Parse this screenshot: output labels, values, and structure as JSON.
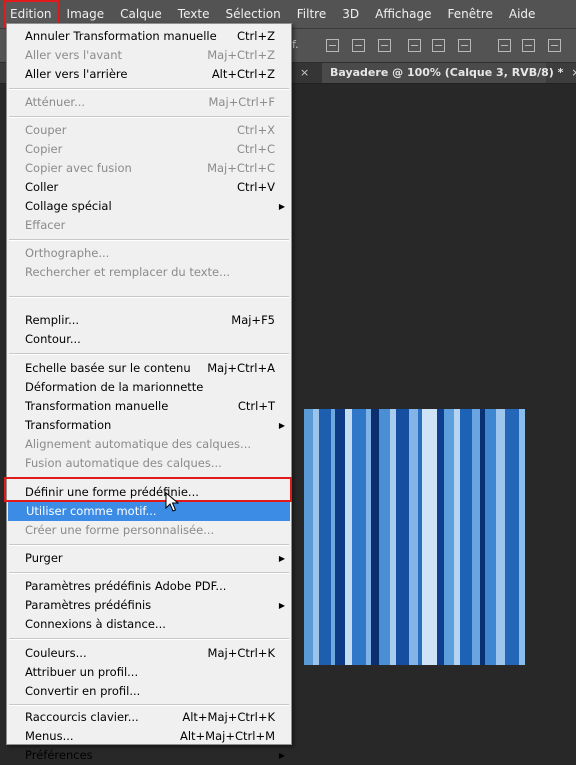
{
  "menubar": {
    "items": [
      "Edition",
      "Image",
      "Calque",
      "Texte",
      "Sélection",
      "Filtre",
      "3D",
      "Affichage",
      "Fenêtre",
      "Aide"
    ]
  },
  "options": {
    "label_fragment": "f."
  },
  "tabs": {
    "active": "Bayadere @ 100% (Calque 3, RVB/8) *",
    "close_glyph": "×"
  },
  "menu": {
    "g1": [
      {
        "label": "Annuler Transformation manuelle",
        "shortcut": "Ctrl+Z",
        "disabled": false
      },
      {
        "label": "Aller vers l'avant",
        "shortcut": "Maj+Ctrl+Z",
        "disabled": true
      },
      {
        "label": "Aller vers l'arrière",
        "shortcut": "Alt+Ctrl+Z",
        "disabled": false
      }
    ],
    "g2": [
      {
        "label": "Atténuer...",
        "shortcut": "Maj+Ctrl+F",
        "disabled": true
      }
    ],
    "g3": [
      {
        "label": "Couper",
        "shortcut": "Ctrl+X",
        "disabled": true
      },
      {
        "label": "Copier",
        "shortcut": "Ctrl+C",
        "disabled": true
      },
      {
        "label": "Copier avec fusion",
        "shortcut": "Maj+Ctrl+C",
        "disabled": true
      },
      {
        "label": "Coller",
        "shortcut": "Ctrl+V",
        "disabled": false
      },
      {
        "label": "Collage spécial",
        "shortcut": "",
        "disabled": false,
        "submenu": true
      },
      {
        "label": "Effacer",
        "shortcut": "",
        "disabled": true
      }
    ],
    "g4": [
      {
        "label": "Orthographe...",
        "shortcut": "",
        "disabled": true
      },
      {
        "label": "Rechercher et remplacer du texte...",
        "shortcut": "",
        "disabled": true
      }
    ],
    "g5": [
      {
        "label": "Remplir...",
        "shortcut": "Maj+F5",
        "disabled": false
      },
      {
        "label": "Contour...",
        "shortcut": "",
        "disabled": false
      }
    ],
    "g6": [
      {
        "label": "Echelle basée sur le contenu",
        "shortcut": "Maj+Ctrl+A",
        "disabled": false
      },
      {
        "label": "Déformation de la marionnette",
        "shortcut": "",
        "disabled": false
      },
      {
        "label": "Transformation manuelle",
        "shortcut": "Ctrl+T",
        "disabled": false
      },
      {
        "label": "Transformation",
        "shortcut": "",
        "disabled": false,
        "submenu": true
      },
      {
        "label": "Alignement automatique des calques...",
        "shortcut": "",
        "disabled": true
      },
      {
        "label": "Fusion automatique des calques...",
        "shortcut": "",
        "disabled": true
      }
    ],
    "g7": [
      {
        "label": "Définir une forme prédéfinie...",
        "shortcut": "",
        "disabled": false
      },
      {
        "label": "Utiliser comme motif...",
        "shortcut": "",
        "disabled": false,
        "highlight": true
      },
      {
        "label": "Créer une forme personnalisée...",
        "shortcut": "",
        "disabled": true
      }
    ],
    "g8": [
      {
        "label": "Purger",
        "shortcut": "",
        "disabled": false,
        "submenu": true
      }
    ],
    "g9": [
      {
        "label": "Paramètres prédéfinis Adobe PDF...",
        "shortcut": "",
        "disabled": false
      },
      {
        "label": "Paramètres prédéfinis",
        "shortcut": "",
        "disabled": false,
        "submenu": true
      },
      {
        "label": "Connexions à distance...",
        "shortcut": "",
        "disabled": false
      }
    ],
    "g10": [
      {
        "label": "Couleurs...",
        "shortcut": "Maj+Ctrl+K",
        "disabled": false
      },
      {
        "label": "Attribuer un profil...",
        "shortcut": "",
        "disabled": false
      },
      {
        "label": "Convertir en profil...",
        "shortcut": "",
        "disabled": false
      }
    ],
    "g11": [
      {
        "label": "Raccourcis clavier...",
        "shortcut": "Alt+Maj+Ctrl+K",
        "disabled": false
      },
      {
        "label": "Menus...",
        "shortcut": "Alt+Maj+Ctrl+M",
        "disabled": false
      },
      {
        "label": "Préférences",
        "shortcut": "",
        "disabled": false,
        "submenu": true
      }
    ]
  },
  "colors": {
    "highlight": "#3c8ce6",
    "annotation_red": "#e0191b",
    "stripes": [
      "#5b9bd5",
      "#9cc3ea",
      "#1d5fae",
      "#6fa7df",
      "#0d3b85",
      "#c4dcf3",
      "#2f78c8",
      "#7fb2e5",
      "#0a2e6e",
      "#4a8fd4",
      "#a9cbee",
      "#164f9f",
      "#82b5e6",
      "#2a6fbf",
      "#d0e3f6",
      "#0f4090",
      "#5c9fdc",
      "#b6d3f1",
      "#1c63b5",
      "#6aa5e1",
      "#093272",
      "#3f86d0",
      "#9ec6ec",
      "#2467b9",
      "#8bbbe9"
    ]
  }
}
